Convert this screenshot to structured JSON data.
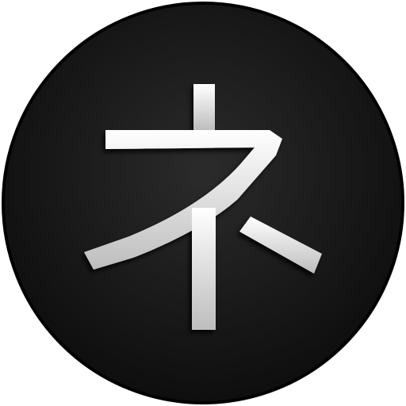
{
  "icon": {
    "name": "katakana-ne-icon",
    "glyph": "ネ",
    "colors": {
      "background_outer": "#0d0d0d",
      "background_inner": "#2b2b2b",
      "ring": "#000000",
      "glyph_light": "#ffffff",
      "glyph_dark": "#bdbdbd",
      "page_background": "#ffffff"
    }
  }
}
